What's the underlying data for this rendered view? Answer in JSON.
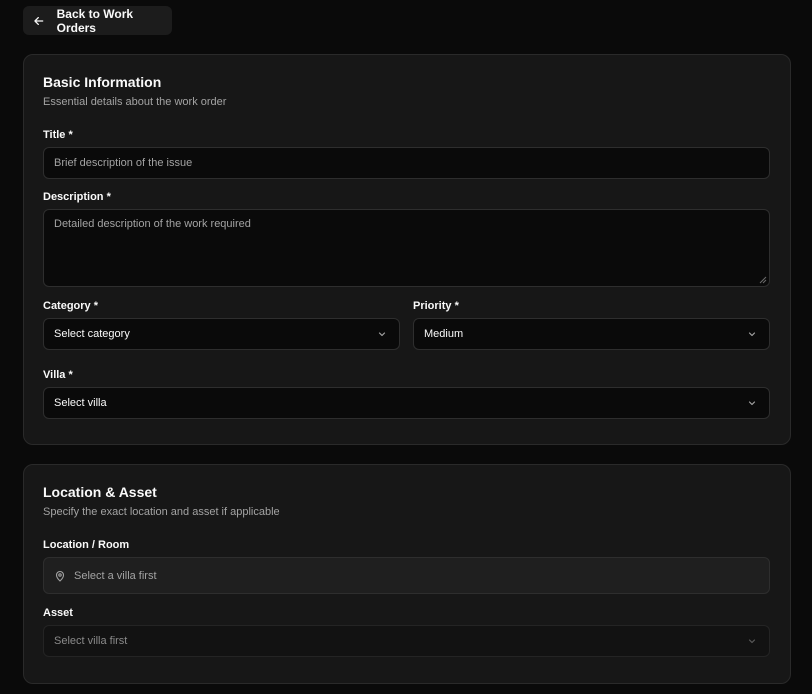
{
  "back_button": {
    "label": "Back to Work Orders"
  },
  "basic_info": {
    "title": "Basic Information",
    "description": "Essential details about the work order",
    "title_field": {
      "label": "Title *",
      "placeholder": "Brief description of the issue"
    },
    "description_field": {
      "label": "Description *",
      "placeholder": "Detailed description of the work required"
    },
    "category_field": {
      "label": "Category *",
      "value": "Select category"
    },
    "priority_field": {
      "label": "Priority *",
      "value": "Medium"
    },
    "villa_field": {
      "label": "Villa *",
      "value": "Select villa"
    }
  },
  "location_asset": {
    "title": "Location & Asset",
    "description": "Specify the exact location and asset if applicable",
    "location_field": {
      "label": "Location / Room",
      "value": "Select a villa first"
    },
    "asset_field": {
      "label": "Asset",
      "value": "Select villa first"
    }
  },
  "icons": {
    "back": "arrow-left-icon",
    "select": "chevron-down-icon",
    "location": "map-pin-icon"
  },
  "colors": {
    "background": "#0a0a0a",
    "card": "#171717",
    "border": "#2a2a2a",
    "text": "#fafafa",
    "muted": "#a3a3a3"
  }
}
